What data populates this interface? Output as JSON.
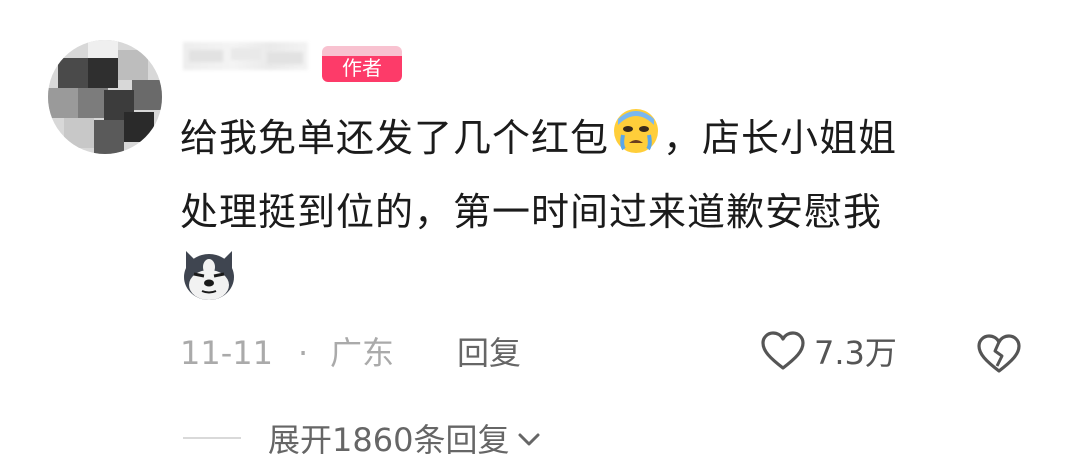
{
  "comment": {
    "author_badge": "作者",
    "text_line1": "给我免单还发了几个红包",
    "text_line1_tail": "，店长小姐姐",
    "text_line2": "处理挺到位的，第一时间过来道歉安慰我",
    "emojis": [
      "crying-face-emoji",
      "husky-dog-emoji"
    ],
    "date": "11-11",
    "separator": "·",
    "location": "广东",
    "reply_label": "回复",
    "like_count": "7.3万",
    "expand_replies_label": "展开1860条回复"
  },
  "colors": {
    "badge": "#fd3b69",
    "text": "#1b1b1b",
    "meta": "#aaaaaa"
  }
}
